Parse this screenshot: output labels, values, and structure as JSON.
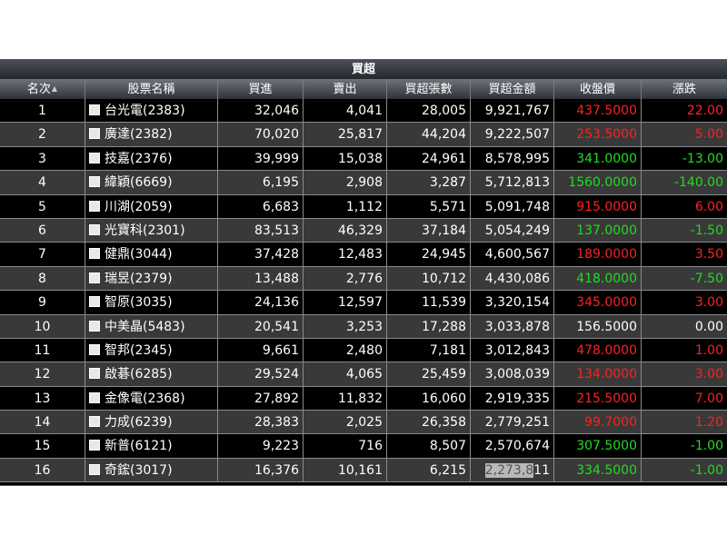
{
  "banner": "買超",
  "headers": [
    "名次",
    "股票名稱",
    "買進",
    "賣出",
    "買超張數",
    "買超金額",
    "收盤價",
    "漲跌"
  ],
  "colors": {
    "up": "#ff2020",
    "down": "#20dd20",
    "flat": "#ffffff"
  },
  "rows": [
    {
      "rank": "1",
      "name": "台光電(2383)",
      "buy": "32,046",
      "sell": "4,041",
      "net": "28,005",
      "amount": "9,921,767",
      "close": "437.5000",
      "change": "22.00",
      "dir": "up"
    },
    {
      "rank": "2",
      "name": "廣達(2382)",
      "buy": "70,020",
      "sell": "25,817",
      "net": "44,204",
      "amount": "9,222,507",
      "close": "253.5000",
      "change": "5.00",
      "dir": "up"
    },
    {
      "rank": "3",
      "name": "技嘉(2376)",
      "buy": "39,999",
      "sell": "15,038",
      "net": "24,961",
      "amount": "8,578,995",
      "close": "341.0000",
      "change": "-13.00",
      "dir": "down"
    },
    {
      "rank": "4",
      "name": "緯穎(6669)",
      "buy": "6,195",
      "sell": "2,908",
      "net": "3,287",
      "amount": "5,712,813",
      "close": "1560.0000",
      "change": "-140.00",
      "dir": "down"
    },
    {
      "rank": "5",
      "name": "川湖(2059)",
      "buy": "6,683",
      "sell": "1,112",
      "net": "5,571",
      "amount": "5,091,748",
      "close": "915.0000",
      "change": "6.00",
      "dir": "up"
    },
    {
      "rank": "6",
      "name": "光寶科(2301)",
      "buy": "83,513",
      "sell": "46,329",
      "net": "37,184",
      "amount": "5,054,249",
      "close": "137.0000",
      "change": "-1.50",
      "dir": "down"
    },
    {
      "rank": "7",
      "name": "健鼎(3044)",
      "buy": "37,428",
      "sell": "12,483",
      "net": "24,945",
      "amount": "4,600,567",
      "close": "189.0000",
      "change": "3.50",
      "dir": "up"
    },
    {
      "rank": "8",
      "name": "瑞昱(2379)",
      "buy": "13,488",
      "sell": "2,776",
      "net": "10,712",
      "amount": "4,430,086",
      "close": "418.0000",
      "change": "-7.50",
      "dir": "down"
    },
    {
      "rank": "9",
      "name": "智原(3035)",
      "buy": "24,136",
      "sell": "12,597",
      "net": "11,539",
      "amount": "3,320,154",
      "close": "345.0000",
      "change": "3.00",
      "dir": "up"
    },
    {
      "rank": "10",
      "name": "中美晶(5483)",
      "buy": "20,541",
      "sell": "3,253",
      "net": "17,288",
      "amount": "3,033,878",
      "close": "156.5000",
      "change": "0.00",
      "dir": "flat"
    },
    {
      "rank": "11",
      "name": "智邦(2345)",
      "buy": "9,661",
      "sell": "2,480",
      "net": "7,181",
      "amount": "3,012,843",
      "close": "478.0000",
      "change": "1.00",
      "dir": "up"
    },
    {
      "rank": "12",
      "name": "啟碁(6285)",
      "buy": "29,524",
      "sell": "4,065",
      "net": "25,459",
      "amount": "3,008,039",
      "close": "134.0000",
      "change": "3.00",
      "dir": "up"
    },
    {
      "rank": "13",
      "name": "金像電(2368)",
      "buy": "27,892",
      "sell": "11,832",
      "net": "16,060",
      "amount": "2,919,335",
      "close": "215.5000",
      "change": "7.00",
      "dir": "up"
    },
    {
      "rank": "14",
      "name": "力成(6239)",
      "buy": "28,383",
      "sell": "2,025",
      "net": "26,358",
      "amount": "2,779,251",
      "close": "99.7000",
      "change": "1.20",
      "dir": "up"
    },
    {
      "rank": "15",
      "name": "新普(6121)",
      "buy": "9,223",
      "sell": "716",
      "net": "8,507",
      "amount": "2,570,674",
      "close": "307.5000",
      "change": "-1.00",
      "dir": "down"
    },
    {
      "rank": "16",
      "name": "奇鋐(3017)",
      "buy": "16,376",
      "sell": "10,161",
      "net": "6,215",
      "amount_selected": "2,273,8",
      "amount_rest": "11",
      "close": "334.5000",
      "change": "-1.00",
      "dir": "down"
    }
  ]
}
